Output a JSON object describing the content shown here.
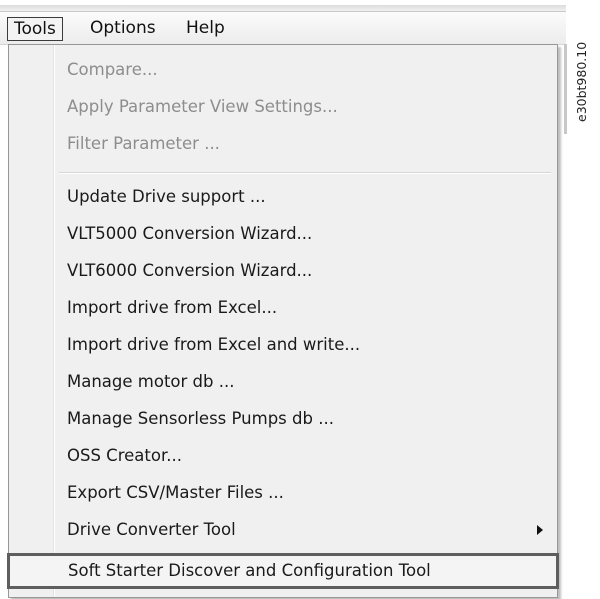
{
  "menubar": {
    "menus": [
      "Tools",
      "Options",
      "Help"
    ]
  },
  "tools_menu": {
    "items": [
      {
        "label": "Compare...",
        "enabled": false
      },
      {
        "label": "Apply Parameter View Settings...",
        "enabled": false
      },
      {
        "label": "Filter Parameter ...",
        "enabled": false
      },
      {
        "label": "Update Drive support ...",
        "enabled": true
      },
      {
        "label": "VLT5000 Conversion Wizard...",
        "enabled": true
      },
      {
        "label": "VLT6000 Conversion Wizard...",
        "enabled": true
      },
      {
        "label": "Import drive from Excel...",
        "enabled": true
      },
      {
        "label": "Import drive from Excel and write...",
        "enabled": true
      },
      {
        "label": "Manage motor db ...",
        "enabled": true
      },
      {
        "label": "Manage Sensorless Pumps db ...",
        "enabled": true
      },
      {
        "label": "OSS Creator...",
        "enabled": true
      },
      {
        "label": "Export CSV/Master Files ...",
        "enabled": true
      },
      {
        "label": "Drive Converter Tool",
        "enabled": true,
        "submenu": true
      },
      {
        "label": "Soft Starter Discover and Configuration Tool",
        "enabled": true,
        "highlighted": true
      }
    ]
  },
  "document_id": "e30bt980.10",
  "icons": {
    "submenu": "chevron-right-icon"
  }
}
